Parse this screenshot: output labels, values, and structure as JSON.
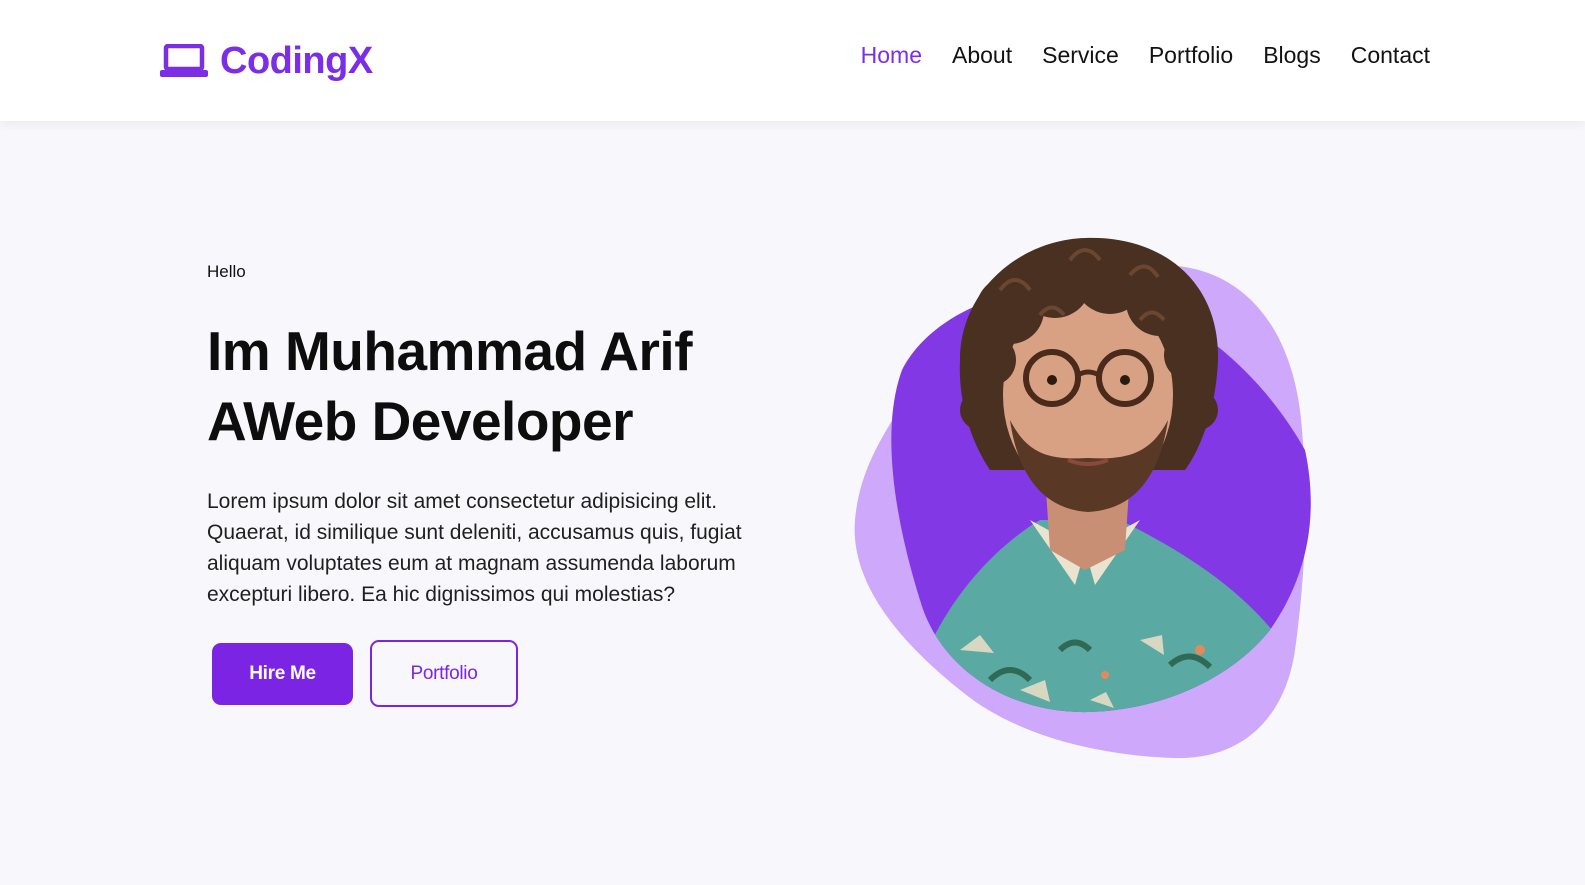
{
  "brand": {
    "name": "CodingX",
    "icon": "laptop-icon",
    "color": "#7b2ee6"
  },
  "nav": {
    "items": [
      {
        "label": "Home",
        "active": true
      },
      {
        "label": "About",
        "active": false
      },
      {
        "label": "Service",
        "active": false
      },
      {
        "label": "Portfolio",
        "active": false
      },
      {
        "label": "Blogs",
        "active": false
      },
      {
        "label": "Contact",
        "active": false
      }
    ]
  },
  "hero": {
    "greeting": "Hello",
    "headline_line1": "Im Muhammad Arif",
    "headline_line2": "AWeb Developer",
    "description": "Lorem ipsum dolor sit amet consectetur adipisicing elit. Quaerat, id similique sunt deleniti, accusamus quis, fugiat aliquam voluptates eum at magnam assumenda laborum excepturi libero. Ea hic dignissimos qui molestias?",
    "primary_button": "Hire Me",
    "secondary_button": "Portfolio",
    "portrait": "person-portrait"
  },
  "colors": {
    "accent": "#7b24e3",
    "blob_light": "#cda8fb",
    "blob_dark": "#8338e6",
    "background": "#f8f7fc"
  }
}
